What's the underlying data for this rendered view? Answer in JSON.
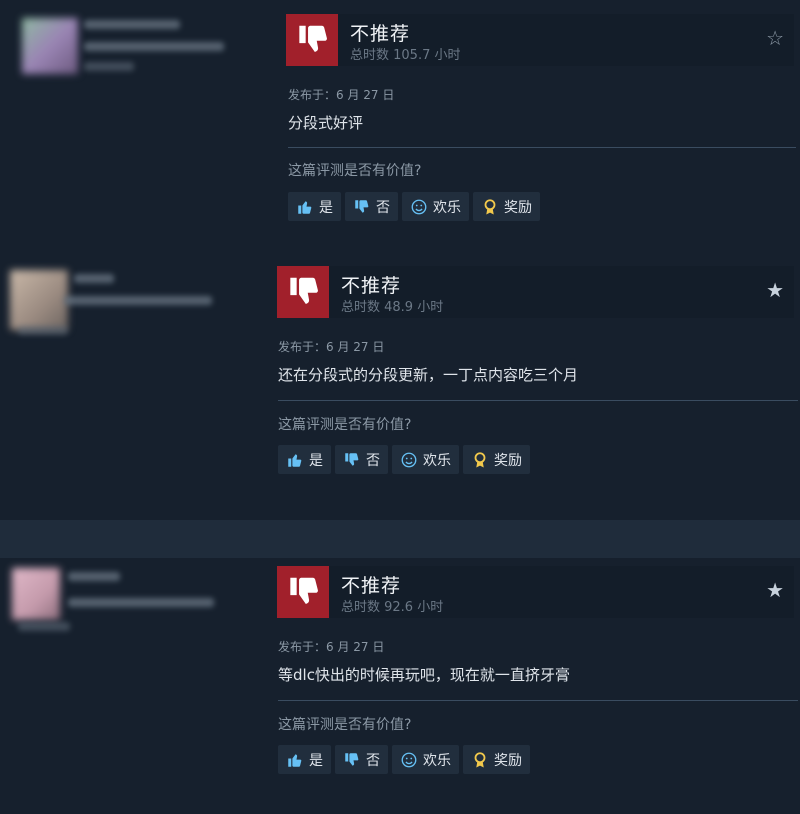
{
  "reviews": [
    {
      "verdict": "不推荐",
      "hours": "总时数 105.7 小时",
      "posted": "发布于：6 月 27 日",
      "text": "分段式好评",
      "helpful_question": "这篇评测是否有价值?",
      "buttons": {
        "yes": "是",
        "no": "否",
        "funny": "欢乐",
        "award": "奖励"
      },
      "star_color": "#8b98a5"
    },
    {
      "verdict": "不推荐",
      "hours": "总时数 48.9 小时",
      "posted": "发布于：6 月 27 日",
      "text": "还在分段式的分段更新，一丁点内容吃三个月",
      "helpful_question": "这篇评测是否有价值?",
      "buttons": {
        "yes": "是",
        "no": "否",
        "funny": "欢乐",
        "award": "奖励"
      },
      "star_color": "#c7d1dc"
    },
    {
      "verdict": "不推荐",
      "hours": "总时数 92.6 小时",
      "posted": "发布于：6 月 27 日",
      "text": "等dlc快出的时候再玩吧，现在就一直挤牙膏",
      "helpful_question": "这篇评测是否有价值?",
      "buttons": {
        "yes": "是",
        "no": "否",
        "funny": "欢乐",
        "award": "奖励"
      },
      "star_color": "#c7d1dc"
    }
  ],
  "colors": {
    "background": "#1b2838",
    "thumbs_down": "#a1202b",
    "button_icon": "#66c0f4",
    "award_icon": "#f2c94c"
  },
  "icons": {
    "verdict": "thumbs-down-icon",
    "yes": "thumbs-up-icon",
    "no": "thumbs-down-icon",
    "funny": "smiley-icon",
    "award": "award-ribbon-icon",
    "star": "star-icon"
  }
}
